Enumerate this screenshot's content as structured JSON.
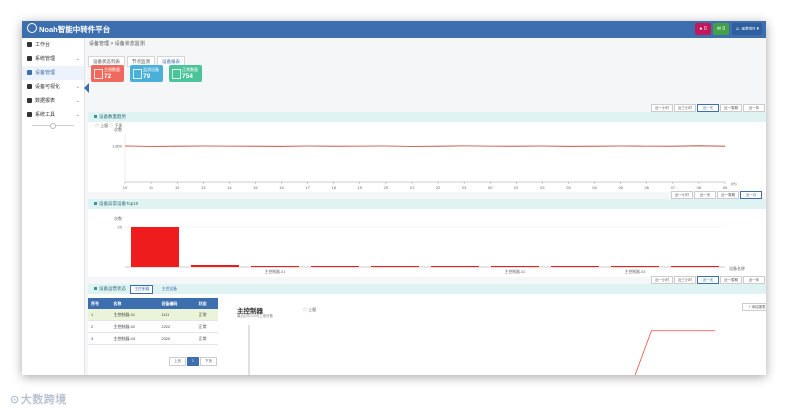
{
  "app": {
    "title": "Noah智能中转件平台"
  },
  "header": {
    "badge1": "0",
    "badge2": "0",
    "user": "admin",
    "colors": {
      "bar": "#3d6fae",
      "badge1": "#c2185b",
      "badge2": "#43a047",
      "user": "#3d6fae"
    }
  },
  "sidebar": {
    "items": [
      {
        "label": "工作台",
        "icon": "home-icon"
      },
      {
        "label": "系统管理",
        "icon": "gear-icon"
      },
      {
        "label": "设备管理",
        "icon": "share-icon"
      },
      {
        "label": "设备可视化",
        "icon": "eye-icon"
      },
      {
        "label": "数据报表",
        "icon": "report-icon"
      },
      {
        "label": "系统工具",
        "icon": "tool-icon"
      }
    ]
  },
  "breadcrumb": [
    "设备管理",
    "设备状态监测"
  ],
  "tabs": [
    "设备状态列表",
    "节点监测",
    "设备报表"
  ],
  "stats": [
    {
      "label": "主线数量",
      "value": "72",
      "color": "#ef6a5e"
    },
    {
      "label": "监测设备",
      "value": "79",
      "color": "#4ab0d9"
    },
    {
      "label": "正常数量",
      "value": "754",
      "color": "#4cc49a"
    }
  ],
  "range_buttons": [
    "近一小时",
    "近三小时",
    "近一天",
    "近一周期",
    "近一年"
  ],
  "range_buttons_2": [
    "近一小时",
    "近一天",
    "近一周期",
    "近一月"
  ],
  "section1": {
    "title": "设备数量趋势",
    "legend": [
      "上报",
      "下发"
    ],
    "y_label": "次数",
    "y_tick": "1,800",
    "x_unit": "(H)"
  },
  "section2": {
    "title": "设备异常设备Top10",
    "y_label": "次数",
    "y_tick": "20",
    "x_unit": "设备名称",
    "bar_labels": [
      "主控制器-01",
      "主控制器-02",
      "主控制器-03"
    ]
  },
  "section3": {
    "title": "设备运营状态",
    "chip1": "主控制器",
    "chip2": "主控设备",
    "table": {
      "columns": [
        "序号",
        "名称",
        "设备编码",
        "状态"
      ],
      "rows": [
        [
          "1",
          "主控制器-01",
          "1111",
          "正常"
        ],
        [
          "2",
          "主控制器-02",
          "2222",
          "正常"
        ],
        [
          "3",
          "主控制器-03",
          "2020",
          "正常"
        ]
      ]
    },
    "pager": [
      "上页",
      "1",
      "下页"
    ],
    "detail_title": "主控制器",
    "detail_sub": "最近(2021/09)上报设备",
    "detail_legend": "上报",
    "detail_button": "+ 添加报表",
    "detail_x_unit": "(H)"
  },
  "watermark": "大数跨境",
  "chart_data": [
    {
      "type": "line",
      "title": "设备数量趋势",
      "x": [
        "10",
        "11",
        "12",
        "13",
        "14",
        "15",
        "16",
        "17",
        "18",
        "19",
        "20",
        "21",
        "22",
        "23",
        "00",
        "01",
        "02",
        "03",
        "04",
        "05",
        "06",
        "07",
        "08",
        "09"
      ],
      "series": [
        {
          "name": "上报",
          "values": [
            1800,
            1780,
            1790,
            1800,
            1795,
            1790,
            1785,
            1800,
            1790,
            1795,
            1800,
            1780,
            1790,
            1805,
            1795,
            1790,
            1800,
            1785,
            1790,
            1800,
            1795,
            1790,
            1810,
            1790
          ]
        }
      ],
      "ylim": [
        0,
        2400
      ],
      "ylabel": "次数",
      "xlabel": "(H)"
    },
    {
      "type": "bar",
      "title": "设备异常设备Top10",
      "categories": [
        "",
        "",
        "主控制器-01",
        "",
        "",
        "",
        "主控制器-02",
        "",
        "主控制器-03",
        ""
      ],
      "values": [
        20,
        1,
        0.5,
        0.5,
        0.5,
        0.5,
        0.5,
        0.5,
        0.5,
        0.5
      ],
      "ylim": [
        0,
        22
      ],
      "ylabel": "次数",
      "xlabel": "设备名称"
    },
    {
      "type": "line",
      "title": "主控制器",
      "series": [
        {
          "name": "上报",
          "values": [
            0,
            0,
            0,
            0,
            0,
            0,
            0,
            0,
            0,
            0,
            0,
            0,
            0,
            0,
            0,
            0,
            0,
            0,
            0,
            1,
            1,
            1,
            1
          ]
        }
      ],
      "ylim": [
        0,
        1.1
      ]
    }
  ]
}
